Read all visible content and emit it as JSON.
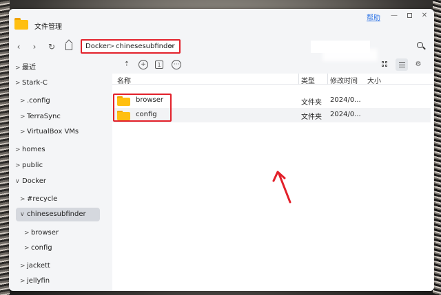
{
  "window": {
    "title": "文件管理",
    "help": "帮助",
    "min_symbol": "—",
    "close_symbol": "✕"
  },
  "nav": {
    "back": "‹",
    "forward": "›",
    "refresh": "↻",
    "path": [
      {
        "label": "Docker",
        "separator": ">"
      },
      {
        "label": "chinesesubfinder",
        "separator": ">"
      }
    ],
    "search_value": ""
  },
  "sidebar": {
    "items": [
      {
        "label": "最近",
        "chevron": ">",
        "level": 0
      },
      {
        "label": "Stark-C",
        "chevron": ">",
        "level": 0
      },
      {
        "label": ".config",
        "chevron": ">",
        "level": 1
      },
      {
        "label": "TerraSync",
        "chevron": ">",
        "level": 1
      },
      {
        "label": "VirtualBox VMs",
        "chevron": ">",
        "level": 1
      },
      {
        "label": "homes",
        "chevron": ">",
        "level": 0
      },
      {
        "label": "public",
        "chevron": ">",
        "level": 0
      },
      {
        "label": "Docker",
        "chevron": "∨",
        "level": 0
      },
      {
        "label": "#recycle",
        "chevron": ">",
        "level": 1
      },
      {
        "label": "chinesesubfinder",
        "chevron": "∨",
        "level": 1,
        "selected": true
      },
      {
        "label": "browser",
        "chevron": ">",
        "level": 2
      },
      {
        "label": "config",
        "chevron": ">",
        "level": 2
      },
      {
        "label": "jackett",
        "chevron": ">",
        "level": 1
      },
      {
        "label": "jellyfin",
        "chevron": ">",
        "level": 1
      }
    ]
  },
  "toolbar": {
    "upload": "⇡",
    "new": "+",
    "copy": "1",
    "more": "···"
  },
  "table": {
    "columns": {
      "name": "名称",
      "type": "类型",
      "modified": "修改时间",
      "size": "大小"
    },
    "rows": [
      {
        "name": "browser",
        "type": "文件夹",
        "modified": "2024/0...",
        "size": ""
      },
      {
        "name": "config",
        "type": "文件夹",
        "modified": "2024/0...",
        "size": ""
      }
    ]
  },
  "colors": {
    "accent_link": "#2e74e6",
    "highlight": "#e2202a",
    "folder": "#ffbf10",
    "selected_bg": "#d5d8de"
  }
}
